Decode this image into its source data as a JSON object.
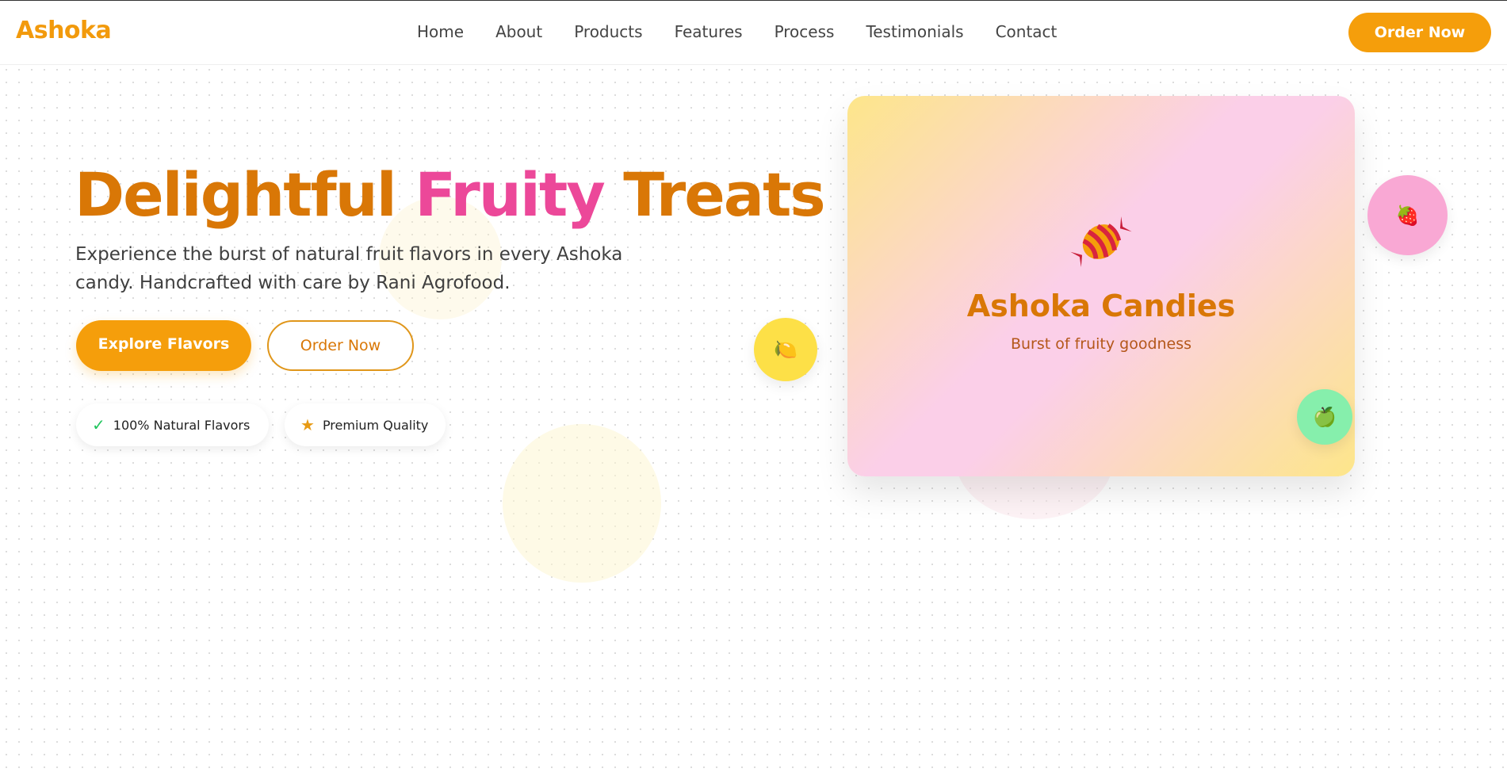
{
  "header": {
    "logo": "Ashoka",
    "nav": [
      {
        "label": "Home"
      },
      {
        "label": "About"
      },
      {
        "label": "Products"
      },
      {
        "label": "Features"
      },
      {
        "label": "Process"
      },
      {
        "label": "Testimonials"
      },
      {
        "label": "Contact"
      }
    ],
    "cta_label": "Order Now"
  },
  "hero": {
    "title_part1": "Delightful ",
    "title_part2": "Fruity",
    "title_part3": " Treats",
    "description": "Experience the burst of natural fruit flavors in every Ashoka candy. Handcrafted with care by Rani Agrofood.",
    "primary_button": "Explore Flavors",
    "secondary_button": "Order Now",
    "badges": [
      {
        "icon": "check-icon",
        "label": "100% Natural Flavors"
      },
      {
        "icon": "star-icon",
        "label": "Premium Quality"
      }
    ]
  },
  "card": {
    "title": "Ashoka Candies",
    "subtitle": "Burst of fruity goodness",
    "icon": "candy-icon"
  },
  "floating_fruits": [
    {
      "icon": "lemon-icon",
      "emoji": "🍋",
      "color": "#fde047"
    },
    {
      "icon": "strawberry-icon",
      "emoji": "🍓",
      "color": "#f9a8d4"
    },
    {
      "icon": "apple-icon",
      "emoji": "🍏",
      "color": "#86efac"
    }
  ],
  "colors": {
    "brand_orange": "#f59e0b",
    "title_orange": "#d97706",
    "accent_pink": "#ec4899",
    "check_green": "#22c55e"
  }
}
